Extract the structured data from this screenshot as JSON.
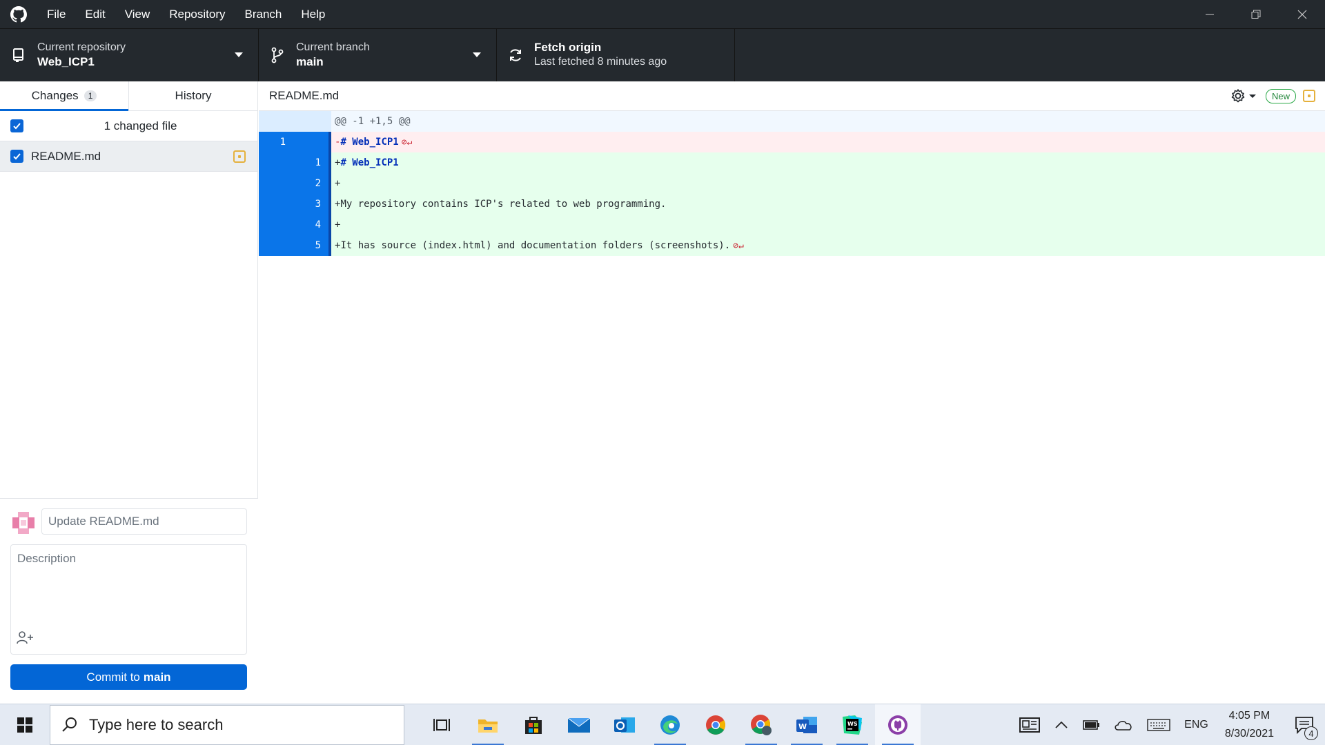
{
  "menu": [
    "File",
    "Edit",
    "View",
    "Repository",
    "Branch",
    "Help"
  ],
  "toolbar": {
    "repo_label": "Current repository",
    "repo_value": "Web_ICP1",
    "branch_label": "Current branch",
    "branch_value": "main",
    "fetch_label": "Fetch origin",
    "fetch_value": "Last fetched 8 minutes ago"
  },
  "sidebar": {
    "tab_changes": "Changes",
    "changes_count": "1",
    "tab_history": "History",
    "changed_files_label": "1 changed file",
    "files": [
      {
        "name": "README.md",
        "status": "modified",
        "checked": true
      }
    ]
  },
  "commit": {
    "summary_placeholder": "Update README.md",
    "description_placeholder": "Description",
    "button_prefix": "Commit to",
    "button_branch": "main"
  },
  "diff": {
    "file": "README.md",
    "new_badge": "New",
    "hunk_header": "@@ -1 +1,5 @@",
    "lines": [
      {
        "type": "del",
        "old": "1",
        "new": "",
        "prefix": "-",
        "keyword": "# Web_ICP1",
        "text": "",
        "noeol": true
      },
      {
        "type": "add",
        "old": "",
        "new": "1",
        "prefix": "+",
        "keyword": "# Web_ICP1",
        "text": "",
        "noeol": false
      },
      {
        "type": "add",
        "old": "",
        "new": "2",
        "prefix": "+",
        "keyword": "",
        "text": "",
        "noeol": false
      },
      {
        "type": "add",
        "old": "",
        "new": "3",
        "prefix": "+",
        "keyword": "",
        "text": "My repository contains ICP's related to web programming.",
        "noeol": false
      },
      {
        "type": "add",
        "old": "",
        "new": "4",
        "prefix": "+",
        "keyword": "",
        "text": "",
        "noeol": false
      },
      {
        "type": "add",
        "old": "",
        "new": "5",
        "prefix": "+",
        "keyword": "",
        "text": "It has source (index.html) and documentation folders (screenshots).",
        "noeol": true
      }
    ]
  },
  "taskbar": {
    "search_placeholder": "Type here to search",
    "apps": [
      "task-view",
      "file-explorer",
      "microsoft-store",
      "mail",
      "outlook",
      "edge",
      "chrome",
      "chrome-profile",
      "word",
      "webstorm",
      "github-desktop"
    ],
    "language": "ENG",
    "time": "4:05 PM",
    "date": "8/30/2021",
    "notification_count": "4"
  }
}
